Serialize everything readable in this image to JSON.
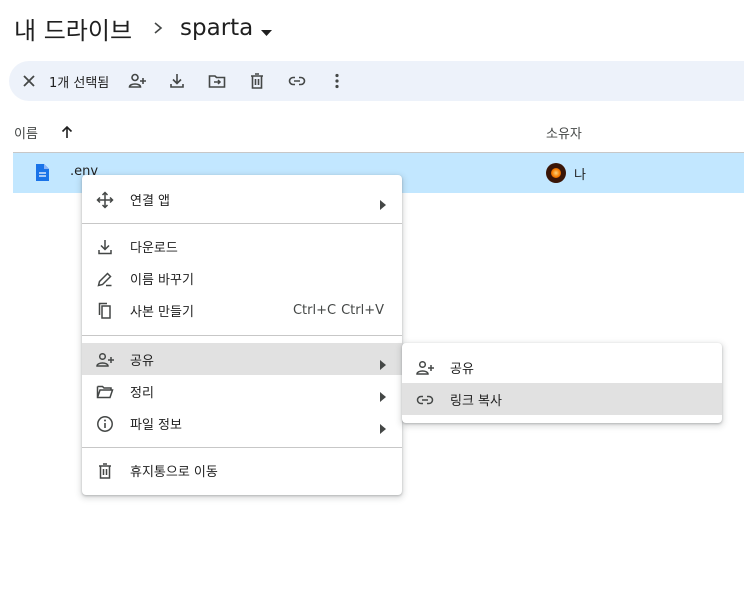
{
  "breadcrumb": {
    "root": "내 드라이브",
    "current": "sparta"
  },
  "selection_bar": {
    "count_label": "1개 선택됨"
  },
  "columns": {
    "name": "이름",
    "owner": "소유자"
  },
  "file_row": {
    "name": ".env",
    "owner": "나"
  },
  "context_menu": {
    "open_with": "연결 앱",
    "download": "다운로드",
    "rename": "이름 바꾸기",
    "make_copy": "사본 만들기",
    "shortcut_1": "Ctrl+C",
    "shortcut_2": "Ctrl+V",
    "share": "공유",
    "organize": "정리",
    "file_info": "파일 정보",
    "move_to_trash": "휴지통으로 이동"
  },
  "share_submenu": {
    "share": "공유",
    "copy_link": "링크 복사"
  },
  "colors": {
    "selected_row": "#c2e7ff",
    "selection_bar": "#edf2fa",
    "menu_highlight": "#e1e1e1",
    "file_icon": "#1a73e8"
  }
}
